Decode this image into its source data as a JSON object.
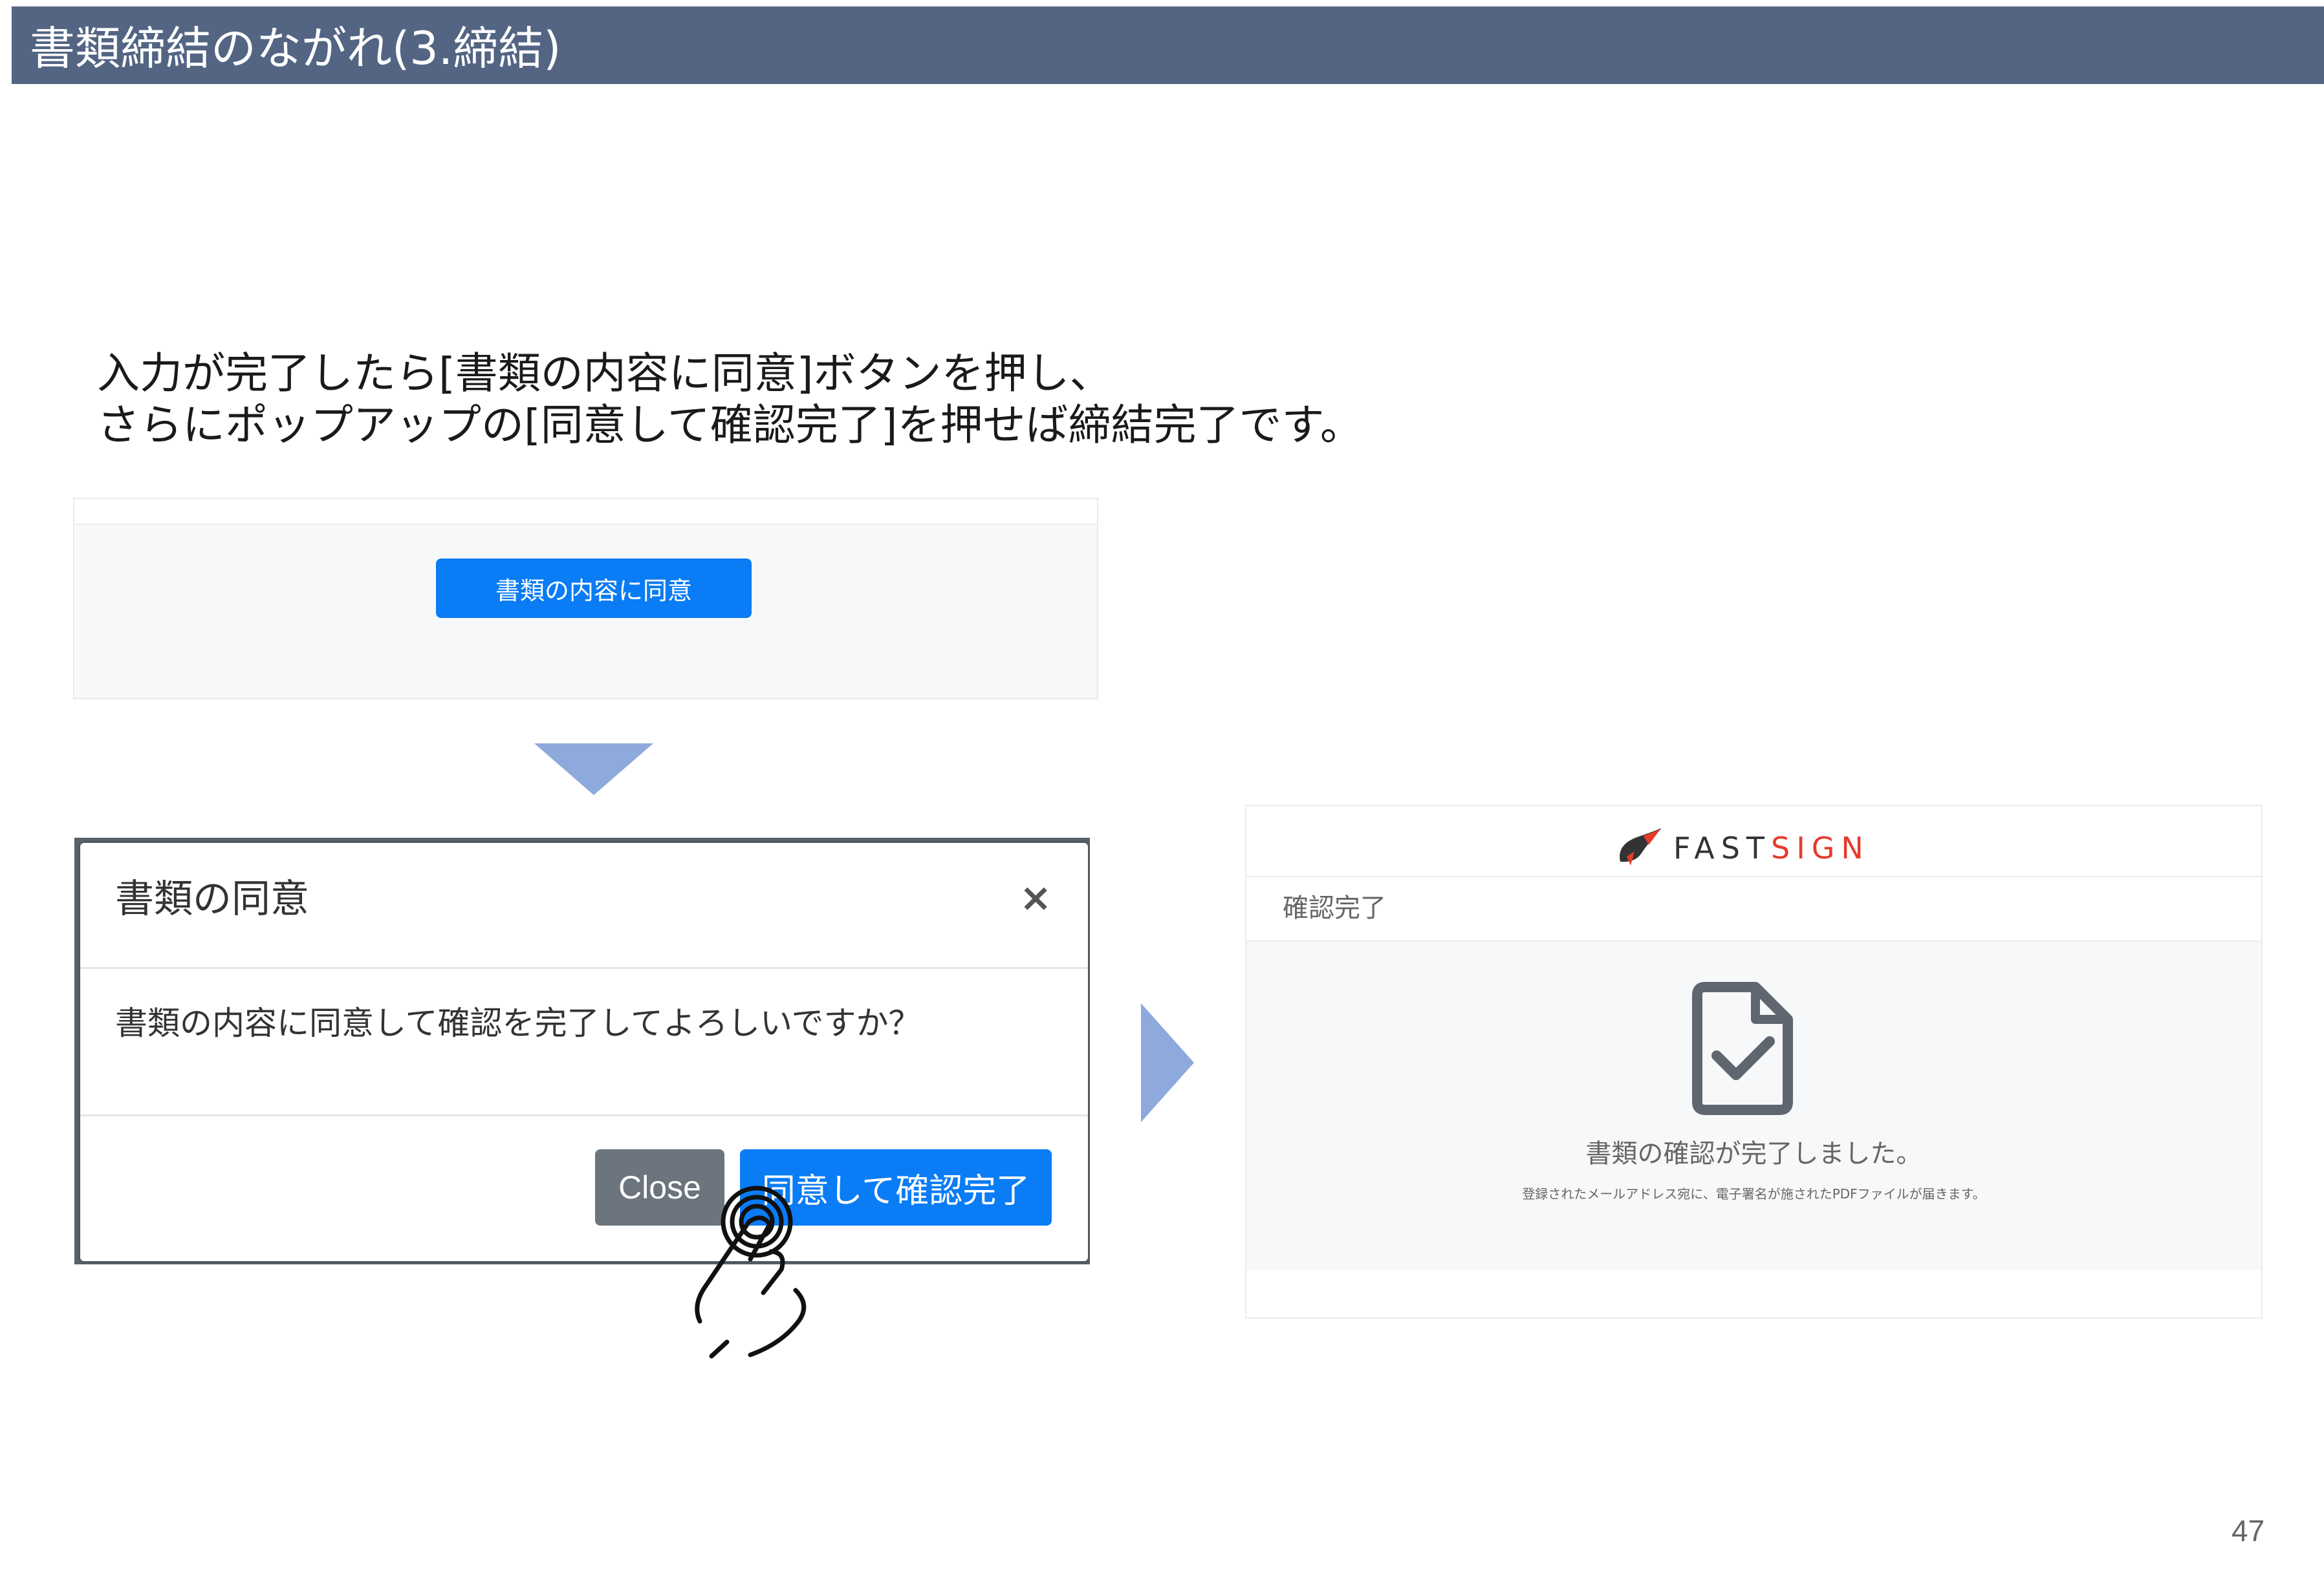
{
  "header": {
    "title": "書類締結のながれ(3.締結)"
  },
  "instructions": {
    "line1": "入力が完了したら[書類の内容に同意]ボタンを押し、",
    "line2": "さらにポップアップの[同意して確認完了]を押せば締結完了です。"
  },
  "step1": {
    "agree_button_label": "書類の内容に同意"
  },
  "modal": {
    "title": "書類の同意",
    "close_symbol": "×",
    "message": "書類の内容に同意して確認を完了してよろしいですか？",
    "close_button_label": "Close",
    "confirm_button_label": "同意して確認完了"
  },
  "completion": {
    "brand_part1": "FAST",
    "brand_part2": "SIGN",
    "header_label": "確認完了",
    "message": "書類の確認が完了しました。",
    "sub_message": "登録されたメールアドレス宛に、電子署名が施されたPDFファイルが届きます。"
  },
  "icons": {
    "hand": "hand-tap-icon",
    "document": "document-check-icon",
    "logo": "fastsign-logo-icon"
  },
  "colors": {
    "header_bg": "#536583",
    "primary": "#0a7cf5",
    "secondary": "#6c757d",
    "arrow": "#8ea9dc",
    "brand_red": "#e53b2b"
  },
  "page_number": "47"
}
